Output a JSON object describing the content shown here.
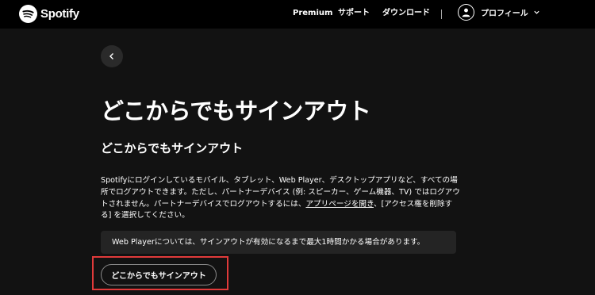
{
  "brand": {
    "name": "Spotify",
    "accent_color": "#1ed760"
  },
  "nav": {
    "premium": "Premium",
    "support": "サポート",
    "download": "ダウンロード",
    "profile": "プロフィール"
  },
  "icons": {
    "logo": "spotify-logo-icon",
    "avatar": "user-icon",
    "profile_menu": "chevron-down-icon",
    "back": "chevron-left-icon"
  },
  "page": {
    "title": "どこからでもサインアウト",
    "subtitle": "どこからでもサインアウト",
    "description_part1": "Spotifyにログインしているモバイル、タブレット、Web Player、デスクトップアプリなど、すべての場所でログアウトできます。ただし、パートナーデバイス (例: スピーカー、ゲーム機器、TV) ではログアウトされません。パートナーデバイスでログアウトするには、",
    "description_link": "アプリページを開き",
    "description_part2": "、[アクセス権を削除する] を選択してください。",
    "note": "Web Playerについては、サインアウトが有効になるまで最大1時間かかる場合があります。",
    "signout_button": "どこからでもサインアウト"
  },
  "annotation": {
    "highlight_color": "#e03a3a"
  }
}
